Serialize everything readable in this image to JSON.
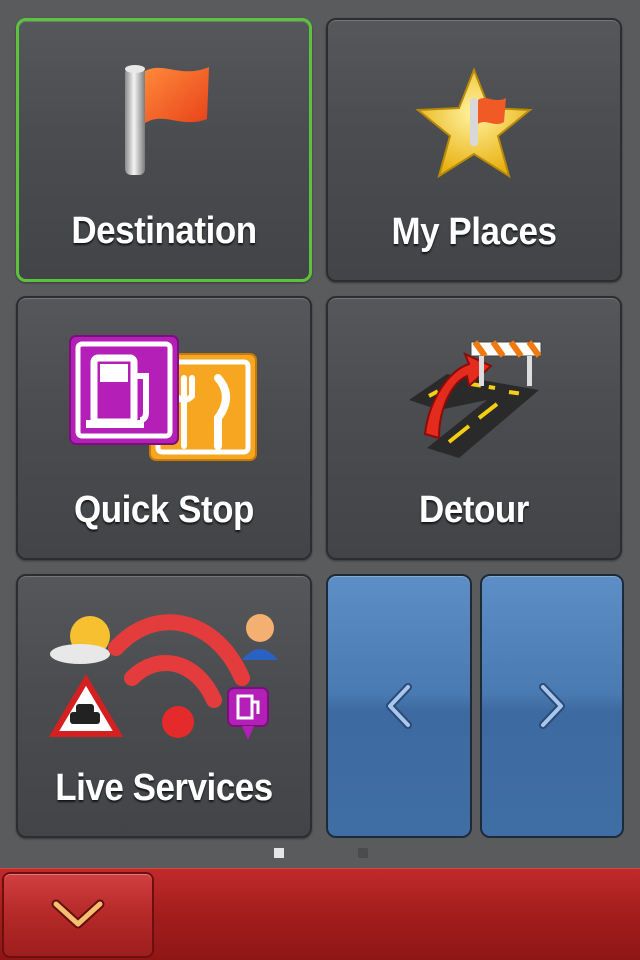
{
  "menu": {
    "tiles": [
      {
        "label": "Destination",
        "icon": "flag-icon",
        "selected": true
      },
      {
        "label": "My Places",
        "icon": "star-flag-icon",
        "selected": false
      },
      {
        "label": "Quick Stop",
        "icon": "fuel-restaurant-icon",
        "selected": false
      },
      {
        "label": "Detour",
        "icon": "detour-road-icon",
        "selected": false
      },
      {
        "label": "Live Services",
        "icon": "live-services-icon",
        "selected": false
      }
    ],
    "prev_button": {
      "icon": "chevron-left-icon"
    },
    "next_button": {
      "icon": "chevron-right-icon"
    }
  },
  "pagination": {
    "current_page": 1,
    "total_pages": 2
  },
  "bottom_bar": {
    "collapse_button": {
      "icon": "chevron-down-icon"
    }
  },
  "colors": {
    "background": "#5a5b5d",
    "selected_border": "#5bc43c",
    "nav_blue": "#4a7ab2",
    "bottom_red": "#a31d1d"
  }
}
